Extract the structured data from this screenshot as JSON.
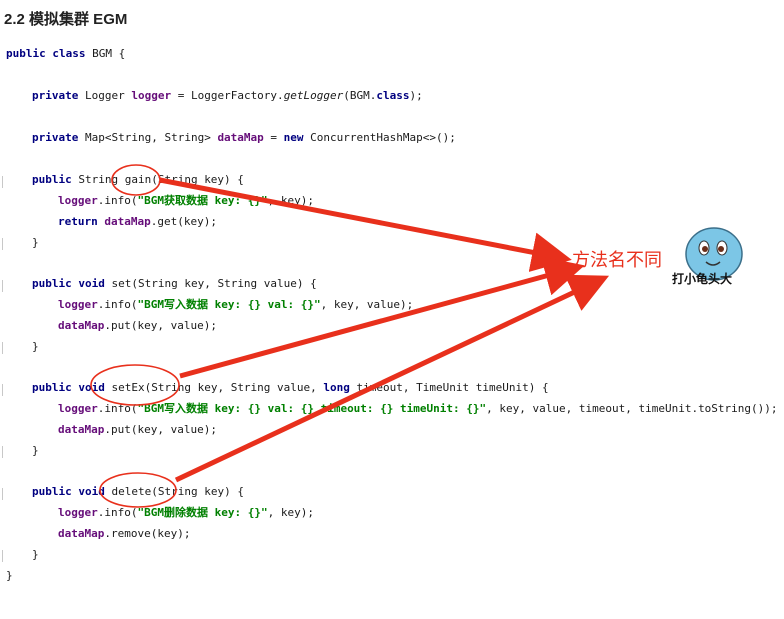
{
  "heading": "2.2 模拟集群 EGM",
  "code": {
    "class_open": {
      "kw": "public class ",
      "rest": "BGM {"
    },
    "logger_line": {
      "kw": "private ",
      "type": "Logger ",
      "field": "logger",
      "eq": " = LoggerFactory.",
      "method": "getLogger",
      "arg": "(BGM.",
      "kw2": "class",
      "end": ");"
    },
    "map_line": {
      "kw": "private ",
      "type": "Map<String, String> ",
      "field": "dataMap",
      "eq": " = ",
      "kw2": "new ",
      "rest": "ConcurrentHashMap<>();"
    },
    "gain_sig": {
      "kw": "public ",
      "rest": "String gain(String key) {"
    },
    "gain_log": {
      "field": "logger",
      "call": ".info(",
      "str": "\"BGM获取数据 key: {}\"",
      "rest": ", key);"
    },
    "gain_ret": {
      "kw": "return ",
      "field": "dataMap",
      "rest": ".get(key);"
    },
    "close": "}",
    "set_sig": {
      "kw": "public void ",
      "rest": "set(String key, String value) {"
    },
    "set_log": {
      "field": "logger",
      "call": ".info(",
      "str": "\"BGM写入数据 key: {} val: {}\"",
      "rest": ", key, value);"
    },
    "set_put": {
      "field": "dataMap",
      "rest": ".put(key, value);"
    },
    "setex_sig": {
      "kw": "public void ",
      "rest": "setEx(String key, String value, ",
      "kw2": "long ",
      "rest2": "timeout, TimeUnit timeUnit) {"
    },
    "setex_log": {
      "field": "logger",
      "call": ".info(",
      "str": "\"BGM写入数据 key: {} val: {} timeout: {} timeUnit: {}\"",
      "rest": ", key, value, timeout, timeUnit.toString());"
    },
    "setex_put": {
      "field": "dataMap",
      "rest": ".put(key, value);"
    },
    "del_sig": {
      "kw": "public void ",
      "rest": "delete(String key) {"
    },
    "del_log": {
      "field": "logger",
      "call": ".info(",
      "str": "\"BGM删除数据 key: {}\"",
      "rest": ", key);"
    },
    "del_rem": {
      "field": "dataMap",
      "rest": ".remove(key);"
    }
  },
  "annotation": {
    "callout": "方法名不同",
    "mascot_caption": "打小龟头大",
    "color": "#e8301c"
  }
}
